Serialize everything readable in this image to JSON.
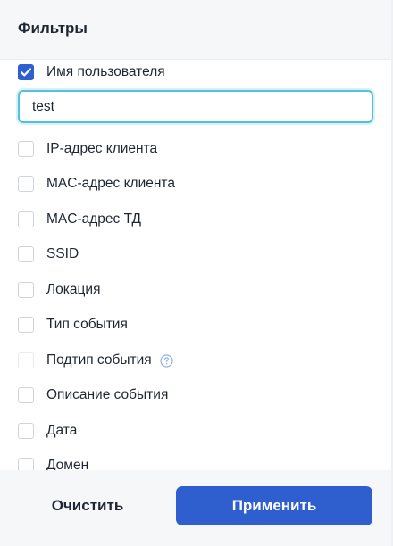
{
  "header": {
    "title": "Фильтры"
  },
  "filters": {
    "username": {
      "label": "Имя пользователя",
      "checked": true,
      "input_value": "test"
    },
    "client_ip": {
      "label": "IP-адрес клиента",
      "checked": false
    },
    "client_mac": {
      "label": "MAC-адрес клиента",
      "checked": false
    },
    "ap_mac": {
      "label": "MAC-адрес ТД",
      "checked": false
    },
    "ssid": {
      "label": "SSID",
      "checked": false
    },
    "location": {
      "label": "Локация",
      "checked": false
    },
    "event_type": {
      "label": "Тип события",
      "checked": false
    },
    "event_subtype": {
      "label": "Подтип события",
      "checked": false,
      "help_icon": "help-circle-icon"
    },
    "event_description": {
      "label": "Описание события",
      "checked": false
    },
    "date": {
      "label": "Дата",
      "checked": false
    },
    "domain": {
      "label": "Домен",
      "checked": false
    }
  },
  "footer": {
    "clear_label": "Очистить",
    "apply_label": "Применить"
  },
  "colors": {
    "accent": "#2f5fcf",
    "focus_ring": "#52c1d9",
    "header_bg": "#f6f7f9"
  }
}
